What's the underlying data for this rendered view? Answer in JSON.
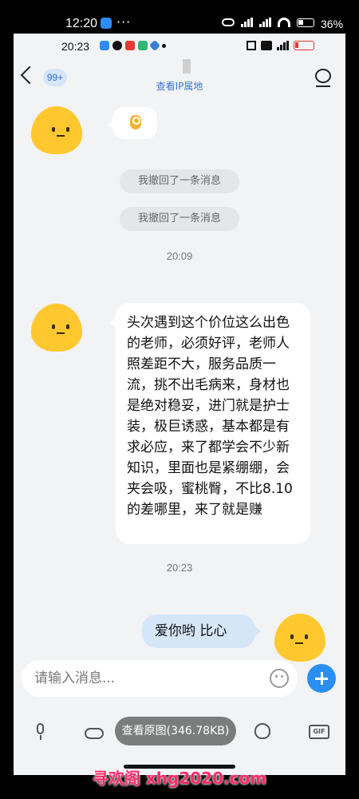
{
  "outer_status": {
    "time": "12:20",
    "dots": "···",
    "battery": "36%"
  },
  "inner_status": {
    "time": "20:23"
  },
  "nav": {
    "unread_badge": "99+",
    "subtitle": "查看IP属地"
  },
  "messages": {
    "recalled_1": "我撤回了一条消息",
    "recalled_2": "我撤回了一条消息",
    "time_1": "20:09",
    "long_text": "头次遇到这个价位这么出色的老师，必须好评，老师人照差距不大，服务品质一流，挑不出毛病来，身材也是绝对稳妥，进门就是护士装，极巨诱惑，基本都是有求必应，来了都学会不少新知识，里面也是紧绷绷，会夹会吸，蜜桃臀，不比8.10的差哪里，来了就是赚",
    "time_2": "20:23",
    "outgoing_text": "爱你哟 比心"
  },
  "input": {
    "placeholder": "请输入消息..."
  },
  "overlay": {
    "view_original": "查看原图(346.78KB)"
  },
  "toolbar": {
    "gif_label": "GIF"
  },
  "watermark": "寻欢阁 xhg2020.com",
  "colors": {
    "accent_blue": "#2b8ef3",
    "avatar_yellow": "#ffc82e",
    "outgoing_bubble": "#d4e6f8",
    "watermark_pink": "#ff2b6b"
  },
  "icons": [
    "back-chevron-icon",
    "profile-icon",
    "ok-hand-emoji-icon",
    "emoji-icon",
    "plus-icon",
    "mic-icon",
    "cloud-icon",
    "sticker-icon",
    "gif-icon"
  ]
}
